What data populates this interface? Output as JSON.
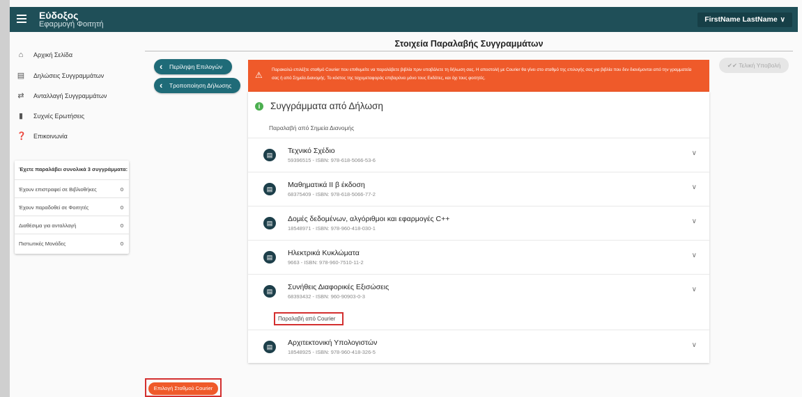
{
  "app": {
    "title": "Εύδοξος",
    "subtitle": "Εφαρμογή Φοιτητή",
    "user_name": "FirstName LastName"
  },
  "sidebar": {
    "items": [
      {
        "label": "Αρχική Σελίδα",
        "icon": "home-icon"
      },
      {
        "label": "Δηλώσεις Συγγραμμάτων",
        "icon": "list-icon"
      },
      {
        "label": "Ανταλλαγή Συγγραμμάτων",
        "icon": "swap-icon"
      },
      {
        "label": "Συχνές Ερωτήσεις",
        "icon": "chat-icon"
      },
      {
        "label": "Επικοινωνία",
        "icon": "help-icon"
      }
    ]
  },
  "stats": {
    "title": "Έχετε παραλάβει συνολικά 3 συγγράμματα:",
    "rows": [
      {
        "label": "Έχουν επιστραφεί σε Βιβλιοθήκες",
        "value": "0"
      },
      {
        "label": "Έχουν παραδοθεί σε Φοιτητές",
        "value": "0"
      },
      {
        "label": "Διαθέσιμα για ανταλλαγή",
        "value": "0"
      },
      {
        "label": "Πιστωτικές Μονάδες",
        "value": "0"
      }
    ]
  },
  "main": {
    "page_title": "Στοιχεία Παραλαβής Συγγραμμάτων",
    "btn_summary": "Περίληψη Επιλογών",
    "btn_edit": "Τροποποίηση Δήλωσης",
    "btn_final": "Τελική Υποβολή",
    "warning_text": "Παρακαλώ επιλέξτε σταθμό Courier που επιθυμείτε να παραλάβετε βιβλία πριν υποβάλετε τη δήλωση σας. Η αποστολή με Courier θα γίνει στο σταθμό της επιλογής σας για βιβλία που δεν διανέμονται από την γραμματεία σας ή από Σημεία Διανομής. Το κόστος της ταχυμεταφοράς επιβαρύνει μόνο τους Εκδότες, και όχι τους φοιτητές.",
    "panel_title": "Συγγράμματα από Δήλωση",
    "pickup_points_label": "Παραλαβή από Σημεία Διανομής",
    "courier_label": "Παραλαβή από Courier",
    "courier_button": "Επιλογή Σταθμού Courier",
    "books_points": [
      {
        "title": "Τεχνικό Σχέδιο",
        "meta": "59396515 - ISBN: 978-618-5066-53-6"
      },
      {
        "title": "Μαθηματικά ΙΙ β έκδοση",
        "meta": "68375409 - ISBN: 978-618-5066-77-2"
      },
      {
        "title": "Δομές δεδομένων, αλγόριθμοι και εφαρμογές C++",
        "meta": "18548971 - ISBN: 978-960-418-030-1"
      },
      {
        "title": "Ηλεκτρικά Κυκλώματα",
        "meta": "9663 - ISBN: 978-960-7510-11-2"
      },
      {
        "title": "Συνήθεις Διαφορικές Εξισώσεις",
        "meta": "68393432 - ISBN: 960-90903-0-3"
      }
    ],
    "books_courier": [
      {
        "title": "Αρχιτεκτονική Υπολογιστών",
        "meta": "18548925 - ISBN: 978-960-418-326-5"
      }
    ]
  },
  "colors": {
    "topbar": "#1f4f58",
    "accent": "#ef5a2a",
    "button": "#1f6b78",
    "highlight": "#d32f2f"
  }
}
